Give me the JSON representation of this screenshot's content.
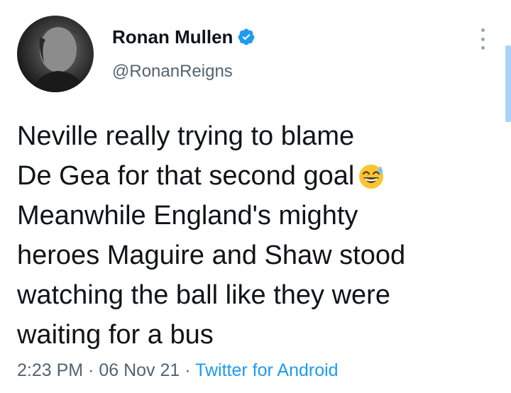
{
  "tweet": {
    "author": {
      "display_name": "Ronan Mullen",
      "handle": "@RonanReigns",
      "verified": true
    },
    "text_lines": [
      "Neville really trying to blame",
      "De Gea for that second goal",
      "Meanwhile England's mighty",
      "heroes Maguire and Shaw stood",
      "watching the ball like they were",
      "waiting for a bus"
    ],
    "emoji": "grinning-face-with-sweat",
    "time": "2:23 PM",
    "date": "06 Nov 21",
    "separator": "·",
    "source": "Twitter for Android"
  },
  "colors": {
    "accent": "#1d9bf0",
    "secondary_text": "#536471",
    "primary_text": "#0f1419"
  }
}
